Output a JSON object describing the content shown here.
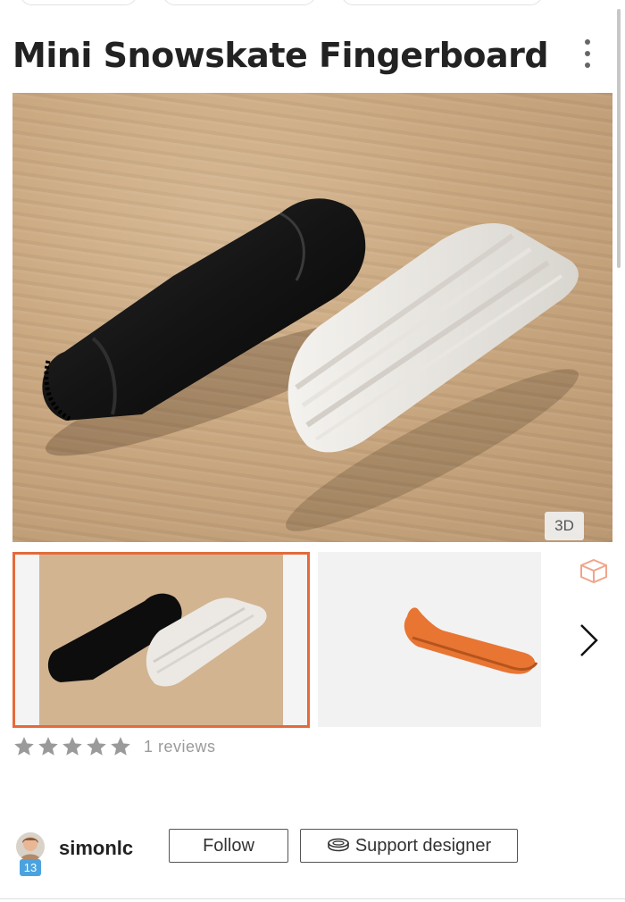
{
  "product": {
    "title": "Mini Snowskate Fingerboard",
    "main_image": {
      "viewer_badge": "3D"
    },
    "gallery": [
      {
        "kind": "photo",
        "selected": true
      },
      {
        "kind": "3d-model",
        "selected": false,
        "icon": "cube-icon"
      }
    ],
    "rating": {
      "stars": 5,
      "reviews_label": "1 reviews"
    }
  },
  "designer": {
    "username": "simonlc",
    "level": "13",
    "follow_label": "Follow",
    "support_label": "Support designer"
  },
  "colors": {
    "accent": "#e46a3c",
    "level_badge": "#4aa3df",
    "star": "#9a9a9a"
  }
}
